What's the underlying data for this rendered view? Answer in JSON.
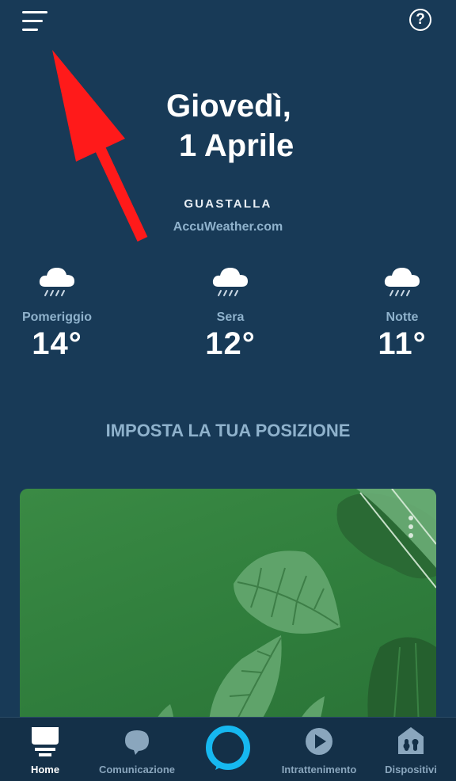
{
  "header": {
    "menu_icon": "hamburger-menu-icon",
    "help_icon": "help-icon",
    "help_glyph": "?"
  },
  "date": {
    "day": "Giovedì,",
    "date": "1 Aprile"
  },
  "weather": {
    "location": "GUASTALLA",
    "source": "AccuWeather.com",
    "icon": "rain-cloud-icon",
    "forecasts": [
      {
        "label": "Pomeriggio",
        "temp": "14°"
      },
      {
        "label": "Sera",
        "temp": "12°"
      },
      {
        "label": "Notte",
        "temp": "11°"
      }
    ]
  },
  "set_location": "IMPOSTA LA TUA POSIZIONE",
  "card": {
    "menu_icon": "more-vertical-icon"
  },
  "nav": {
    "items": [
      {
        "label": "Home",
        "icon": "home-icon",
        "active": true
      },
      {
        "label": "Comunicazione",
        "icon": "chat-bubble-icon",
        "active": false
      },
      {
        "label": "",
        "icon": "alexa-ring-icon",
        "active": false
      },
      {
        "label": "Intrattenimento",
        "icon": "play-icon",
        "active": false
      },
      {
        "label": "Dispositivi",
        "icon": "devices-house-icon",
        "active": false
      }
    ]
  },
  "annotation": {
    "icon": "red-arrow-icon",
    "color": "#ff1a1a"
  }
}
